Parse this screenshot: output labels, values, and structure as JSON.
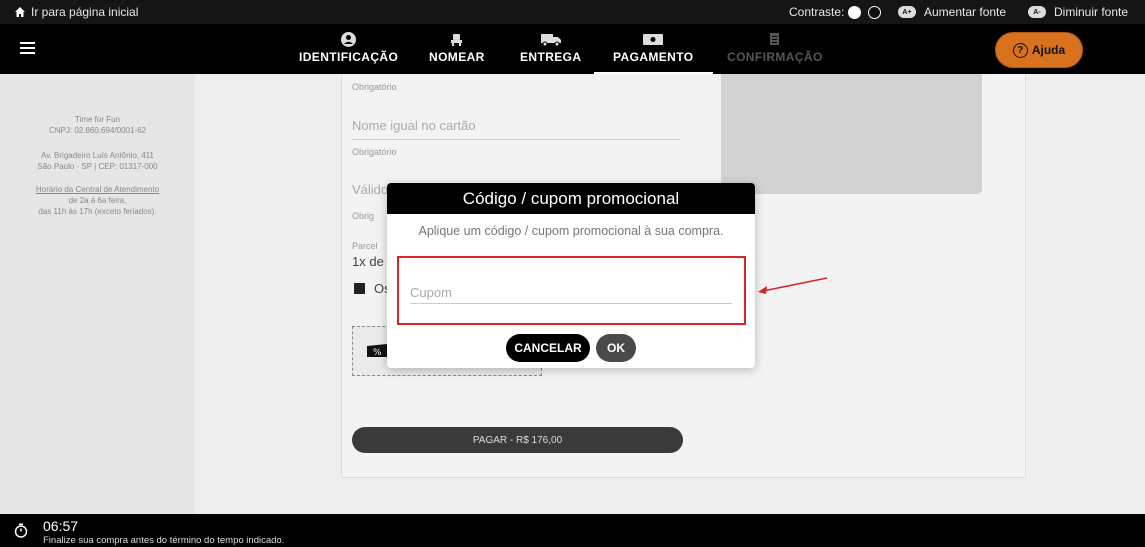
{
  "topbar": {
    "home_link": "Ir para página inicial",
    "contrast_label": "Contraste:",
    "increase_font_badge": "A+",
    "increase_font": "Aumentar fonte",
    "decrease_font_badge": "A-",
    "decrease_font": "Diminuir fonte"
  },
  "nav": {
    "steps": [
      {
        "label": "IDENTIFICAÇÃO",
        "icon": "user-icon"
      },
      {
        "label": "NOMEAR",
        "icon": "seat-icon"
      },
      {
        "label": "ENTREGA",
        "icon": "truck-icon"
      },
      {
        "label": "PAGAMENTO",
        "icon": "card-icon"
      },
      {
        "label": "CONFIRMAÇÃO",
        "icon": "document-icon"
      }
    ],
    "active_step": "PAGAMENTO",
    "help_label": "Ajuda"
  },
  "sidebar": {
    "company_name": "Time for Fun",
    "cnpj": "CNPJ: 02.860.694/0001-62",
    "address_line1": "Av. Brigadeiro Luís Antônio, 411",
    "address_line2": "São Paulo - SP | CEP: 01317-000",
    "hours_link": "Horário da Central de Atendimento",
    "hours_line1": "de 2a à 6a feira,",
    "hours_line2": "das 11h às 17h (exceto feriados)."
  },
  "form": {
    "required_1": "Obrigatório",
    "name_placeholder": "Nome igual no cartão",
    "required_2": "Obrigatório",
    "validity_placeholder": "Válido",
    "required_3": "Obrig",
    "installments_label": "Parcel",
    "installments_value": "1x de",
    "checkbox_label": "Os",
    "pay_button": "PAGAR - R$ 176,00"
  },
  "modal": {
    "title": "Código / cupom promocional",
    "description": "Aplique um código / cupom promocional à sua compra.",
    "coupon_placeholder": "Cupom",
    "cancel_button": "CANCELAR",
    "ok_button": "OK"
  },
  "timer": {
    "time": "06:57",
    "message": "Finalize sua compra antes do término do tempo indicado."
  },
  "colors": {
    "accent": "#d9721c",
    "highlight": "#d8232a"
  }
}
